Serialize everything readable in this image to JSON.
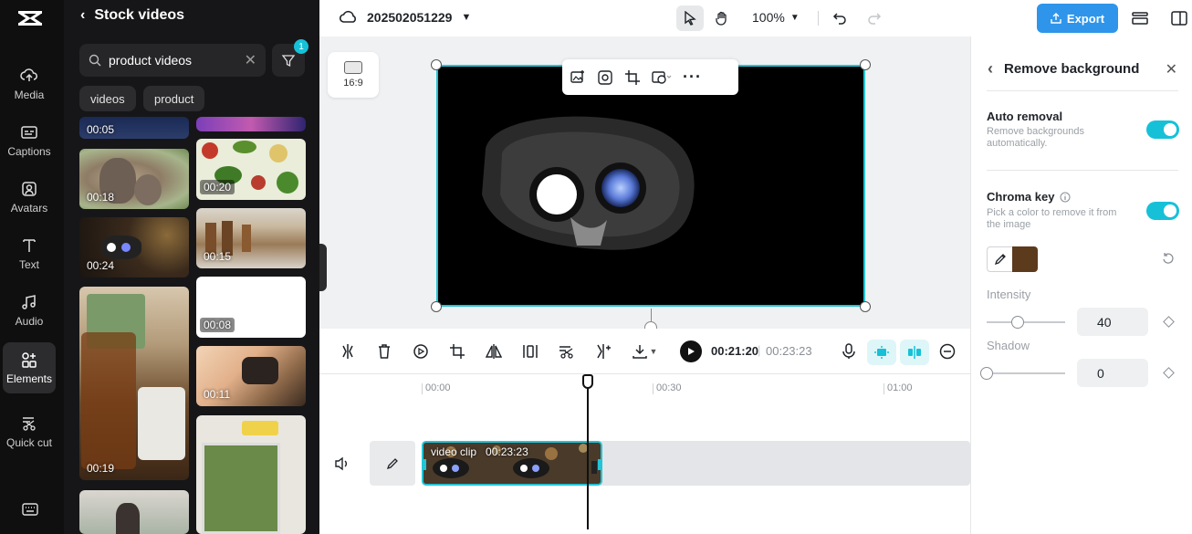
{
  "rail": {
    "items": [
      {
        "label": "Media",
        "icon": "cloud-upload-icon"
      },
      {
        "label": "Captions",
        "icon": "captions-icon"
      },
      {
        "label": "Avatars",
        "icon": "avatar-icon"
      },
      {
        "label": "Text",
        "icon": "text-icon"
      },
      {
        "label": "Audio",
        "icon": "music-note-icon"
      },
      {
        "label": "Elements",
        "icon": "elements-icon",
        "active": true
      },
      {
        "label": "Quick cut",
        "icon": "quick-cut-icon"
      }
    ]
  },
  "panel": {
    "title": "Stock videos",
    "search_value": "product videos",
    "filter_count": "1",
    "chips": [
      "videos",
      "product"
    ],
    "thumbs": [
      {
        "duration": "00:05"
      },
      {
        "duration": "00:18"
      },
      {
        "duration": "00:20"
      },
      {
        "duration": "00:24"
      },
      {
        "duration": "00:15"
      },
      {
        "duration": "00:08"
      },
      {
        "duration": "00:11"
      },
      {
        "duration": "00:19"
      }
    ]
  },
  "topbar": {
    "project_name": "202502051229",
    "zoom": "100%",
    "export_label": "Export"
  },
  "canvas": {
    "ratio_label": "16:9"
  },
  "timeline": {
    "current_time": "00:21:20",
    "total_time": "00:23:23",
    "ruler": [
      "00:00",
      "00:30",
      "01:00"
    ],
    "clip_label": "video clip",
    "clip_duration": "00:23:23"
  },
  "right_panel": {
    "title": "Remove background",
    "auto_removal": {
      "title": "Auto removal",
      "desc": "Remove backgrounds automatically.",
      "enabled": true
    },
    "chroma_key": {
      "title": "Chroma key",
      "desc": "Pick a color to remove it from the image",
      "enabled": true,
      "color": "#5c3a1c"
    },
    "intensity": {
      "label": "Intensity",
      "value": "40"
    },
    "shadow": {
      "label": "Shadow",
      "value": "0"
    }
  },
  "colors": {
    "accent": "#16c1d8",
    "export": "#2e95ea"
  }
}
